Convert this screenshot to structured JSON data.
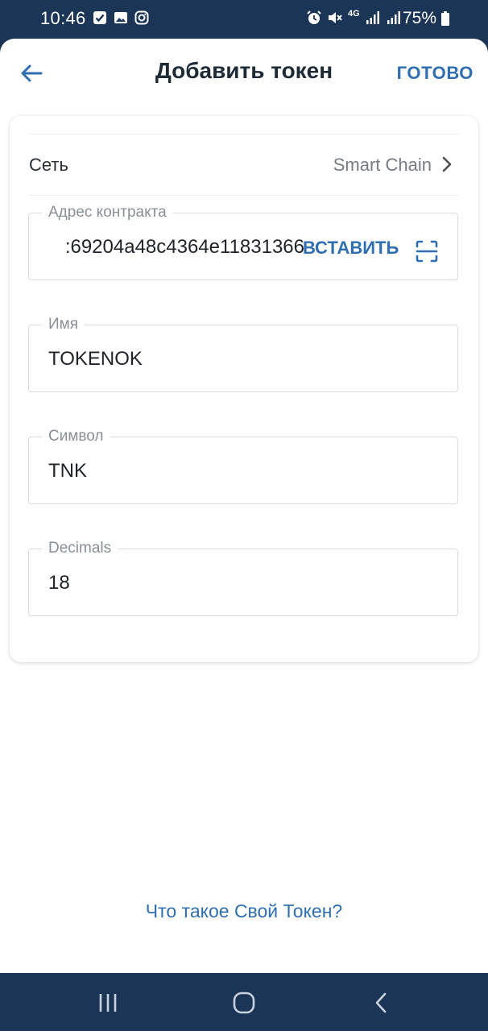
{
  "status_bar": {
    "time": "10:46",
    "battery": "75%",
    "network_type": "4G",
    "icons_left": [
      "checkbox-icon",
      "image-icon",
      "instagram-icon"
    ],
    "icons_right": [
      "alarm-icon",
      "mute-icon",
      "signal-icon",
      "signal-icon",
      "battery-icon"
    ]
  },
  "header": {
    "title": "Добавить токен",
    "done_label": "ГОТОВО"
  },
  "form": {
    "network": {
      "label": "Сеть",
      "value": "Smart Chain"
    },
    "contract_address": {
      "label": "Адрес контракта",
      "value": ":69204a48c4364e11831366",
      "paste_label": "ВСТАВИТЬ"
    },
    "name": {
      "label": "Имя",
      "value": "TOKENOK"
    },
    "symbol": {
      "label": "Символ",
      "value": "TNK"
    },
    "decimals": {
      "label": "Decimals",
      "value": "18"
    }
  },
  "help_link": "Что такое Свой Токен?",
  "colors": {
    "accent": "#2f6fb0",
    "status_bar_bg": "#1b3556",
    "title_text": "#1f2a37"
  }
}
